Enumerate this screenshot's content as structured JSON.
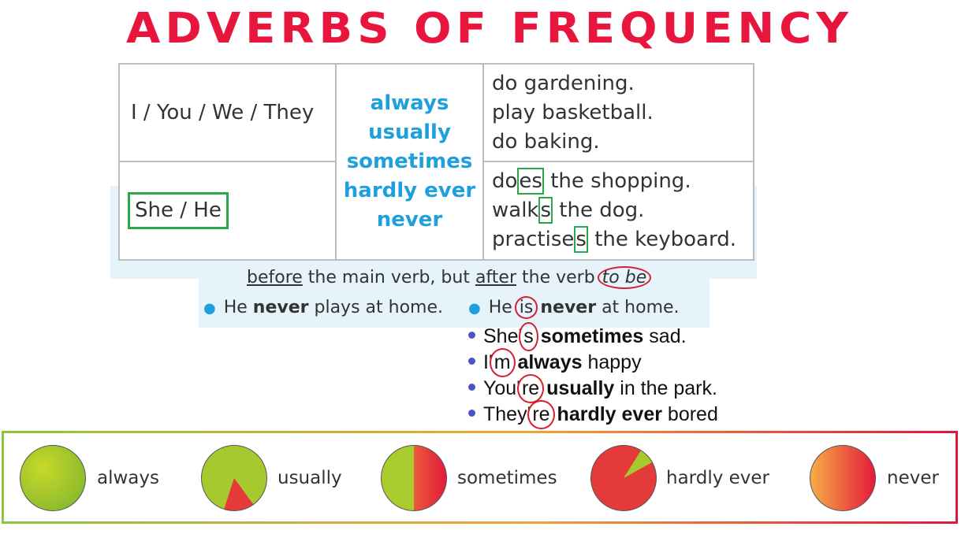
{
  "title": "ADVERBS OF FREQUENCY",
  "table": {
    "row1_subject": "I / You / We / They",
    "row2_subject": "She / He",
    "adverbs": [
      "always",
      "usually",
      "sometimes",
      "hardly ever",
      "never"
    ],
    "row1_objects": [
      "do gardening.",
      "play basketball.",
      "do baking."
    ],
    "row2_objects": [
      {
        "pre": "do",
        "mark": "es",
        "post": " the shopping."
      },
      {
        "pre": "walk",
        "mark": "s",
        "post": " the dog."
      },
      {
        "pre": "practise",
        "mark": "s",
        "post": " the keyboard."
      }
    ]
  },
  "rule": {
    "before": "before",
    "mid": " the main verb, but ",
    "after": "after",
    "mid2": " the verb ",
    "tobe": "to be"
  },
  "examples": {
    "ex1": {
      "pre": "He ",
      "bold": "never",
      "post": " plays at home."
    },
    "ex2": {
      "pre": "He ",
      "verb": "is",
      "bold": "never",
      "post": " at home."
    }
  },
  "list": [
    {
      "pre": "She'",
      "circ": "s",
      "bold": "sometimes",
      "post": " sad."
    },
    {
      "pre": "I'",
      "circ": "m",
      "bold": "always",
      "post": " happy"
    },
    {
      "pre": "You'",
      "circ": "re",
      "bold": "usually",
      "post": " in the park."
    },
    {
      "pre": "They'",
      "circ": "re",
      "bold": "hardly ever",
      "post": " bored"
    }
  ],
  "scale": [
    {
      "label": "always",
      "fill_fraction": 1.0
    },
    {
      "label": "usually",
      "fill_fraction": 0.85
    },
    {
      "label": "sometimes",
      "fill_fraction": 0.5
    },
    {
      "label": "hardly ever",
      "fill_fraction": 0.08
    },
    {
      "label": "never",
      "fill_fraction": 0.0
    }
  ],
  "colors": {
    "title": "#e8163d",
    "adverb": "#1ea0dc",
    "green_box": "#2aa84a",
    "red_circle": "#d42030"
  }
}
